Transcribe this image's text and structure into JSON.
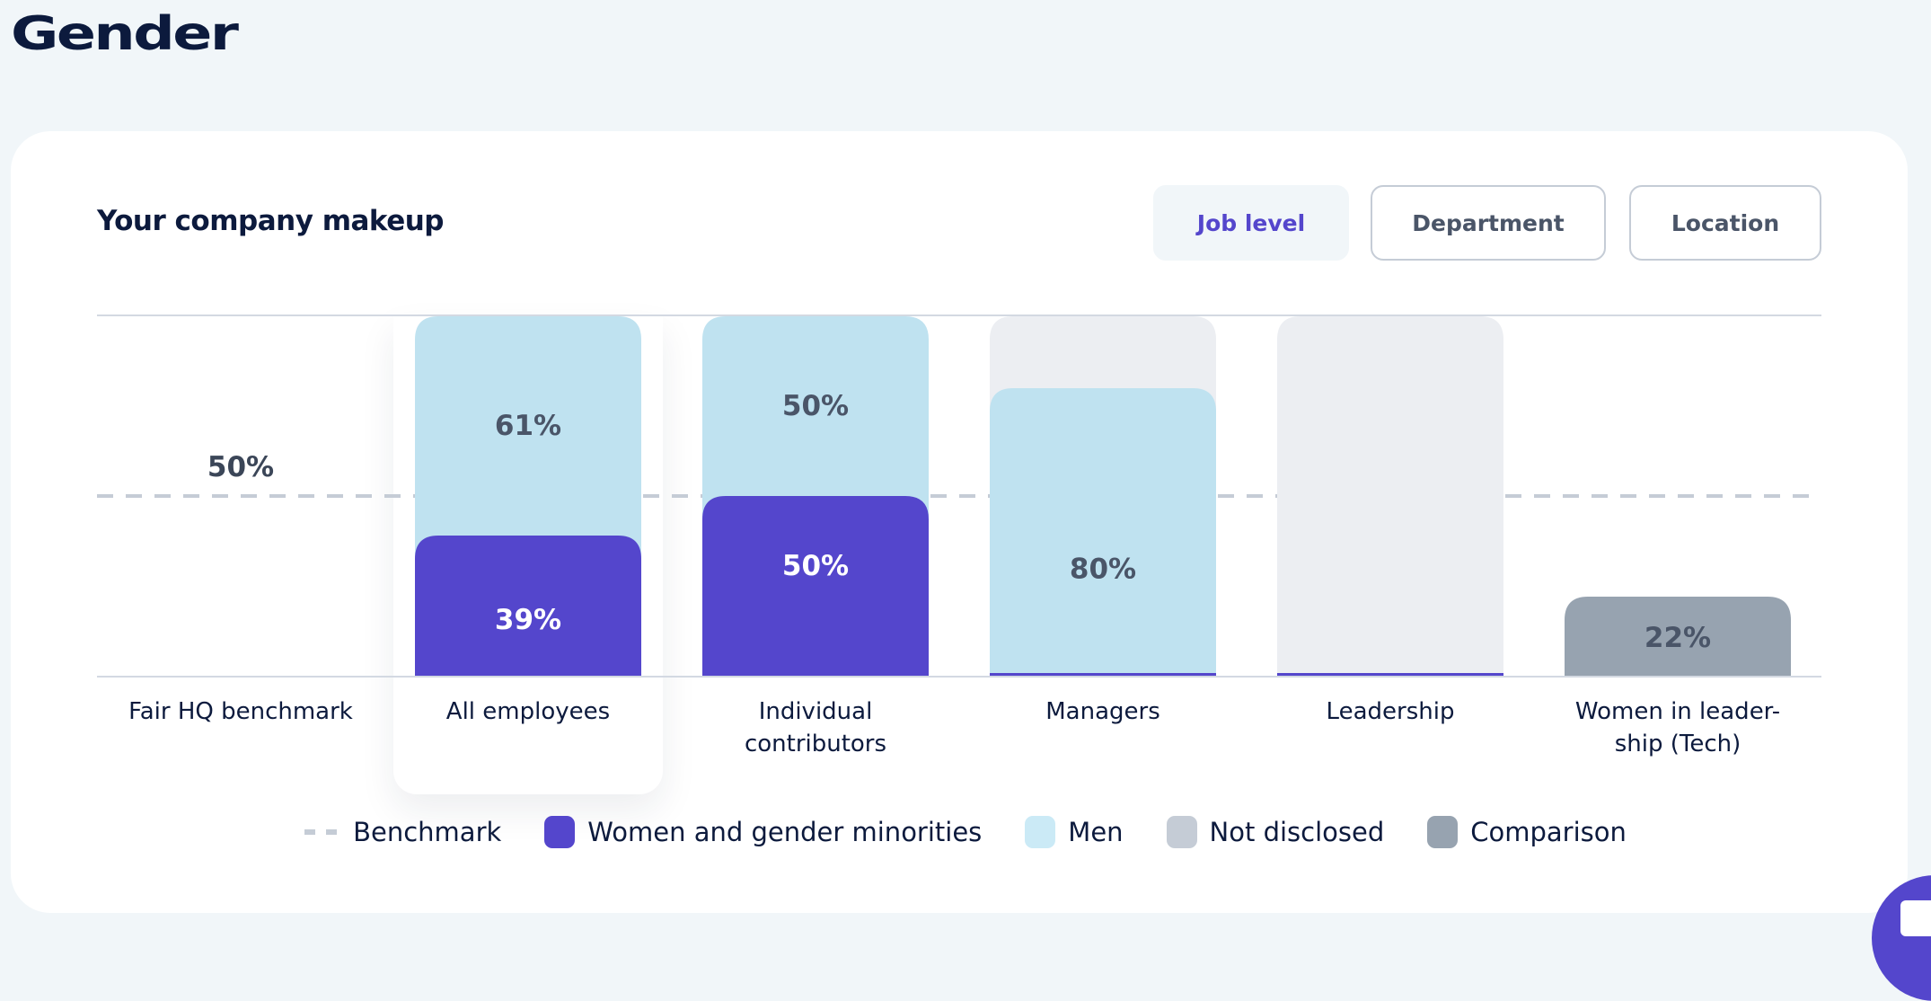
{
  "page": {
    "title": "Gender"
  },
  "card": {
    "title": "Your company makeup",
    "tabs": [
      {
        "label": "Job level",
        "active": true
      },
      {
        "label": "Department",
        "active": false
      },
      {
        "label": "Location",
        "active": false
      }
    ]
  },
  "colors": {
    "women": "#5446cc",
    "men": "#bfe2f0",
    "not_disclosed": "#eceef2",
    "comparison": "#97a3b0",
    "benchmark": "#c5ccd6",
    "label_dark": "#4a5568",
    "label_light": "#ffffff"
  },
  "chart_data": {
    "type": "bar",
    "title": "Your company makeup",
    "xlabel": "",
    "ylabel": "",
    "ylim": [
      0,
      100
    ],
    "grid": false,
    "legend_position": "bottom",
    "categories": [
      "Fair HQ benchmark",
      "All employees",
      "Individual contributors",
      "Managers",
      "Leadership",
      "Women in leader-ship (Tech)"
    ],
    "benchmark": {
      "name": "Benchmark",
      "value": 50,
      "label": "50%"
    },
    "series": [
      {
        "name": "Women and gender minorities",
        "values": [
          null,
          39,
          50,
          0,
          0,
          null
        ],
        "labels": [
          null,
          "39%",
          "50%",
          null,
          null,
          null
        ]
      },
      {
        "name": "Men",
        "values": [
          null,
          61,
          50,
          80,
          0,
          null
        ],
        "labels": [
          null,
          "61%",
          "50%",
          "80%",
          null,
          null
        ]
      },
      {
        "name": "Not disclosed",
        "values": [
          null,
          0,
          0,
          20,
          100,
          null
        ],
        "labels": [
          null,
          null,
          null,
          null,
          null,
          null
        ]
      },
      {
        "name": "Comparison",
        "values": [
          null,
          null,
          null,
          null,
          null,
          22
        ],
        "labels": [
          null,
          null,
          null,
          null,
          null,
          "22%"
        ]
      }
    ],
    "highlighted_category": "All employees"
  },
  "legend": [
    {
      "label": "Benchmark",
      "kind": "dash",
      "color": "#c5ccd6"
    },
    {
      "label": "Women and gender minorities",
      "kind": "swatch",
      "color": "#5446cc"
    },
    {
      "label": "Men",
      "kind": "swatch",
      "color": "#cbeaf6"
    },
    {
      "label": "Not disclosed",
      "kind": "swatch",
      "color": "#c5ccd6"
    },
    {
      "label": "Comparison",
      "kind": "swatch",
      "color": "#97a3b0"
    }
  ],
  "chat": {
    "icon": "chat-icon"
  }
}
